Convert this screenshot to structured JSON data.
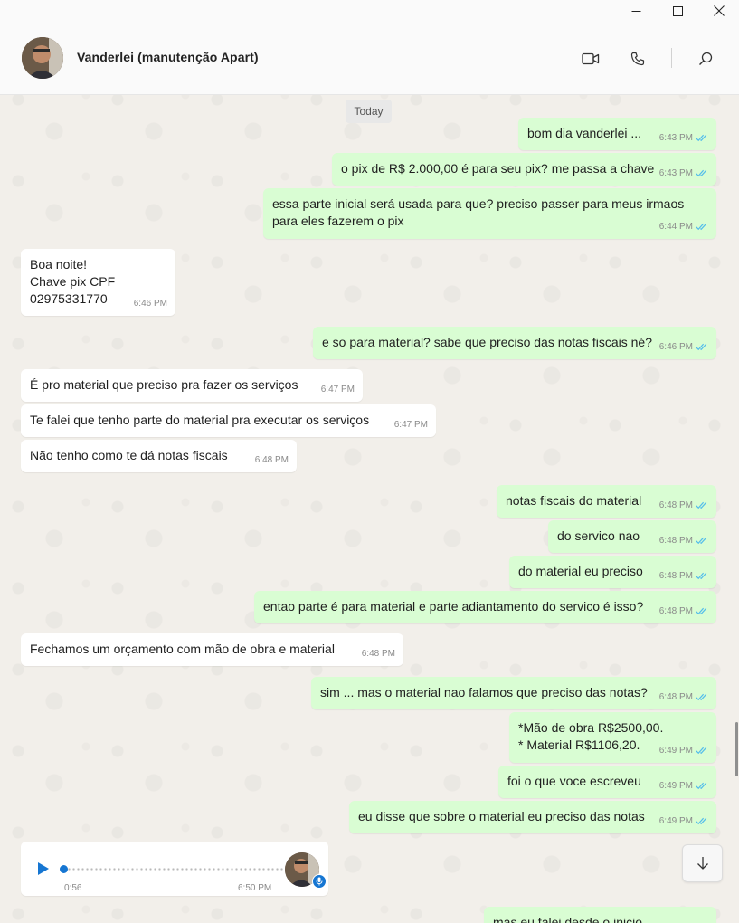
{
  "window": {
    "minimize_icon": "minimize-icon",
    "maximize_icon": "maximize-icon",
    "close_icon": "close-icon"
  },
  "header": {
    "contact_name": "Vanderlei (manutenção Apart)",
    "icons": [
      "video-call-icon",
      "voice-call-icon",
      "search-icon"
    ]
  },
  "chat": {
    "date_label": "Today",
    "messages": [
      {
        "dir": "out",
        "text": "bom dia vanderlei ...",
        "time": "6:43 PM"
      },
      {
        "dir": "out",
        "text": "o pix de R$ 2.000,00 é para seu pix? me passa a chave",
        "time": "6:43 PM"
      },
      {
        "dir": "out",
        "text": "essa parte inicial será usada para que? preciso passer para meus irmaos para eles fazerem o pix",
        "time": "6:44 PM"
      },
      {
        "dir": "in",
        "text": "Boa noite!\nChave pix CPF\n02975331770",
        "time": "6:46 PM"
      },
      {
        "dir": "out",
        "text": "e so para material? sabe que preciso das notas fiscais né?",
        "time": "6:46 PM"
      },
      {
        "dir": "in",
        "text": "É pro material que preciso pra fazer os serviços",
        "time": "6:47 PM"
      },
      {
        "dir": "in",
        "text": "Te falei que tenho parte do material pra executar os serviços",
        "time": "6:47 PM"
      },
      {
        "dir": "in",
        "text": "Não tenho como te dá notas fiscais",
        "time": "6:48 PM"
      },
      {
        "dir": "out",
        "text": "notas fiscais do material",
        "time": "6:48 PM"
      },
      {
        "dir": "out",
        "text": "do servico nao",
        "time": "6:48 PM"
      },
      {
        "dir": "out",
        "text": "do material eu preciso",
        "time": "6:48 PM"
      },
      {
        "dir": "out",
        "text": "entao parte é para material e parte adiantamento do servico é isso?",
        "time": "6:48 PM"
      },
      {
        "dir": "in",
        "text": "Fechamos um orçamento com mão de obra e material",
        "time": "6:48 PM"
      },
      {
        "dir": "out",
        "text": "sim ... mas o material nao falamos que preciso das notas?",
        "time": "6:48 PM"
      },
      {
        "dir": "out",
        "text": "*Mão de obra R$2500,00.\n* Material R$1106,20.",
        "time": "6:49 PM"
      },
      {
        "dir": "out",
        "text": "foi o que voce escreveu",
        "time": "6:49 PM"
      },
      {
        "dir": "out",
        "text": "eu disse que sobre o material eu preciso das notas",
        "time": "6:49 PM"
      },
      {
        "dir": "out",
        "text": "mas eu falei desde o inicio",
        "time": ""
      }
    ],
    "audio": {
      "duration": "0:56",
      "time": "6:50 PM",
      "play_icon": "play-icon",
      "mic_icon": "microphone-icon"
    },
    "scroll_down_icon": "arrow-down-icon",
    "colors": {
      "outgoing": "#d9fdd3",
      "incoming": "#ffffff",
      "tick": "#53bdeb",
      "accent": "#1676d2"
    }
  }
}
